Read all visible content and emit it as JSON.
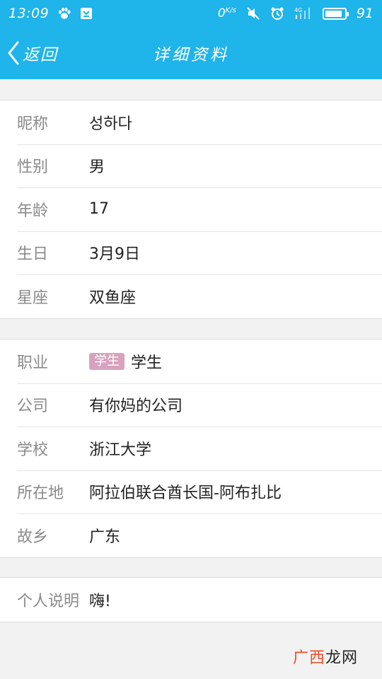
{
  "status_bar": {
    "time": "13:09",
    "net_speed_value": "0",
    "net_speed_unit": "K/s",
    "signal_label": "4G",
    "battery": "91",
    "battery_level": 0.91
  },
  "header": {
    "back_label": "返回",
    "title": "详细资料"
  },
  "sections": [
    {
      "rows": [
        {
          "label": "昵称",
          "value": "성하다"
        },
        {
          "label": "性别",
          "value": "男"
        },
        {
          "label": "年龄",
          "value": "17"
        },
        {
          "label": "生日",
          "value": "3月9日"
        },
        {
          "label": "星座",
          "value": "双鱼座"
        }
      ]
    },
    {
      "rows": [
        {
          "label": "职业",
          "tag": "学生",
          "value": "学生"
        },
        {
          "label": "公司",
          "value": "有你妈的公司"
        },
        {
          "label": "学校",
          "value": "浙江大学"
        },
        {
          "label": "所在地",
          "value": "阿拉伯联合酋长国-阿布扎比"
        },
        {
          "label": "故乡",
          "value": "广东"
        }
      ]
    },
    {
      "rows": [
        {
          "label": "个人说明",
          "value": "嗨!"
        }
      ]
    }
  ],
  "watermark": {
    "accent_text": "广西",
    "text": "龙网"
  },
  "colors": {
    "header": "#1fb4ea",
    "tag": "#d7a2bd",
    "watermark_accent": "#e2502f"
  }
}
